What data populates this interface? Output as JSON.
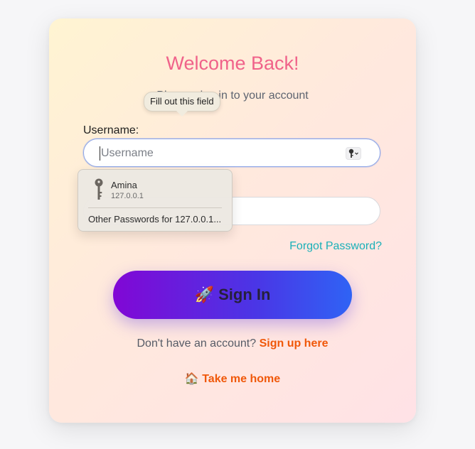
{
  "title": "Welcome Back!",
  "subtitle": "Please sign in to your account",
  "username": {
    "label": "Username:",
    "placeholder": "Username",
    "tooltip": "Fill out this field"
  },
  "autofill": {
    "account_name": "Amina",
    "host": "127.0.0.1",
    "other_passwords": "Other Passwords for 127.0.0.1..."
  },
  "forgot_password": "Forgot Password?",
  "signin_button": {
    "emoji": "🚀",
    "label": "Sign In"
  },
  "signup": {
    "prompt": "Don't have an account?",
    "link": "Sign up here"
  },
  "home": {
    "emoji": "🏠",
    "link": "Take me home"
  },
  "icons": {
    "key": "key-icon",
    "rocket": "rocket-icon",
    "house": "house-icon"
  },
  "colors": {
    "title": "#f0628a",
    "link": "#f0580a",
    "forgot": "#19b0b8",
    "button_start": "#8107d5",
    "button_end": "#2f63f5"
  }
}
